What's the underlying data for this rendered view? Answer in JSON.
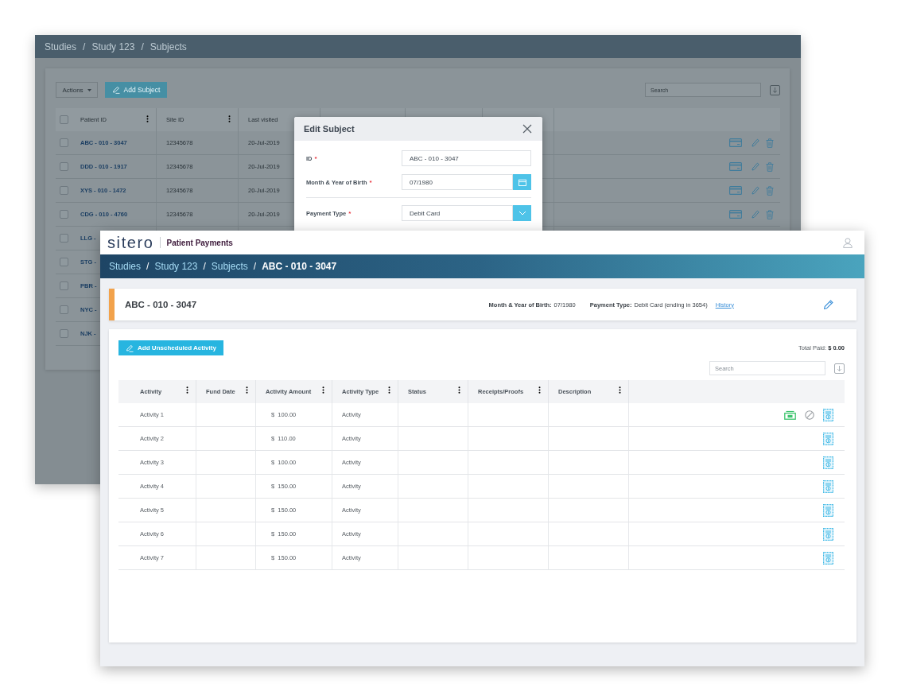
{
  "background_window": {
    "breadcrumb": [
      "Studies",
      "Study 123",
      "Subjects"
    ],
    "breadcrumb_separator": "/",
    "actions_button": "Actions",
    "add_button": "Add Subject",
    "search": {
      "placeholder": "Search"
    },
    "table": {
      "select_all": {
        "checked": false
      },
      "columns": [
        {
          "label": "Patient ID",
          "menu": true
        },
        {
          "label": "Site ID",
          "menu": true
        },
        {
          "label": "Last visited",
          "menu": false
        }
      ],
      "rows": [
        {
          "checked": false,
          "patient_id": "ABC - 010 - 3047",
          "site_id": "12345678",
          "last_visited": "20-Jul-2019",
          "actions": [
            {
              "kind": "card"
            },
            {
              "kind": "edit"
            },
            {
              "kind": "delete"
            }
          ]
        },
        {
          "checked": false,
          "patient_id": "DDD - 010 - 1917",
          "site_id": "12345678",
          "last_visited": "20-Jul-2019",
          "actions": [
            {
              "kind": "card"
            },
            {
              "kind": "edit"
            },
            {
              "kind": "delete"
            }
          ]
        },
        {
          "checked": false,
          "patient_id": "XYS - 010 - 1472",
          "site_id": "12345678",
          "last_visited": "20-Jul-2019",
          "actions": [
            {
              "kind": "card"
            },
            {
              "kind": "edit"
            },
            {
              "kind": "delete"
            }
          ]
        },
        {
          "checked": false,
          "patient_id": "CDG - 010 - 4760",
          "site_id": "12345678",
          "last_visited": "20-Jul-2019",
          "actions": [
            {
              "kind": "card"
            },
            {
              "kind": "edit"
            },
            {
              "kind": "delete"
            }
          ]
        },
        {
          "checked": false,
          "patient_id": "LLG -"
        },
        {
          "checked": false,
          "patient_id": "STG -"
        },
        {
          "checked": false,
          "patient_id": "PBR -"
        },
        {
          "checked": false,
          "patient_id": "NYC -"
        },
        {
          "checked": false,
          "patient_id": "NJK -"
        }
      ]
    },
    "modal": {
      "title": "Edit Subject",
      "fields": [
        {
          "kind": "text",
          "label": "ID",
          "required_mark": "*",
          "value": "ABC - 010 - 3047",
          "divider_above": false
        },
        {
          "kind": "date",
          "label": "Month & Year of Birth",
          "required_mark": "*",
          "value": "07/1980",
          "divider_above": false
        },
        {
          "kind": "select",
          "label": "Payment Type",
          "required_mark": "*",
          "value": "Debit Card",
          "divider_above": true
        }
      ]
    }
  },
  "main_window": {
    "logo": "sitero",
    "app_title": "Patient Payments",
    "breadcrumb": [
      {
        "label": "Studies",
        "current": false
      },
      {
        "label": "Study 123",
        "current": false
      },
      {
        "label": "Subjects",
        "current": false
      },
      {
        "label": "ABC - 010 - 3047",
        "current": true
      }
    ],
    "breadcrumb_separator": "/",
    "subject": {
      "id": "ABC - 010 - 3047",
      "details": [
        {
          "label": "Month & Year of Birth:",
          "value": "07/1980"
        },
        {
          "label": "Payment Type:",
          "value": "Debit Card (ending in 3654)"
        }
      ],
      "history_link": "History"
    },
    "add_button": "Add Unscheduled Activity",
    "total_paid": "Total Paid: **$ 0.00**",
    "search": {
      "placeholder": "Search"
    },
    "table": {
      "columns": [
        "Activity",
        "Fund Date",
        "Activity Amount",
        "Activity Type",
        "Status",
        "Receipts/Proofs",
        "Description"
      ],
      "rows": [
        {
          "activity": "Activity 1",
          "amount": "$  100.00",
          "type": "Activity",
          "actions": [
            {
              "kind": "cash"
            },
            {
              "kind": "void"
            },
            {
              "kind": "receipt"
            }
          ]
        },
        {
          "activity": "Activity 2",
          "amount": "$  110.00",
          "type": "Activity",
          "actions": [
            {
              "kind": "receipt"
            }
          ]
        },
        {
          "activity": "Activity 3",
          "amount": "$  100.00",
          "type": "Activity",
          "actions": [
            {
              "kind": "receipt"
            }
          ]
        },
        {
          "activity": "Activity 4",
          "amount": "$  150.00",
          "type": "Activity",
          "actions": [
            {
              "kind": "receipt"
            }
          ]
        },
        {
          "activity": "Activity 5",
          "amount": "$  150.00",
          "type": "Activity",
          "actions": [
            {
              "kind": "receipt"
            }
          ]
        },
        {
          "activity": "Activity 6",
          "amount": "$  150.00",
          "type": "Activity",
          "actions": [
            {
              "kind": "receipt"
            }
          ]
        },
        {
          "activity": "Activity 7",
          "amount": "$  150.00",
          "type": "Activity",
          "actions": [
            {
              "kind": "receipt"
            }
          ]
        }
      ]
    }
  }
}
